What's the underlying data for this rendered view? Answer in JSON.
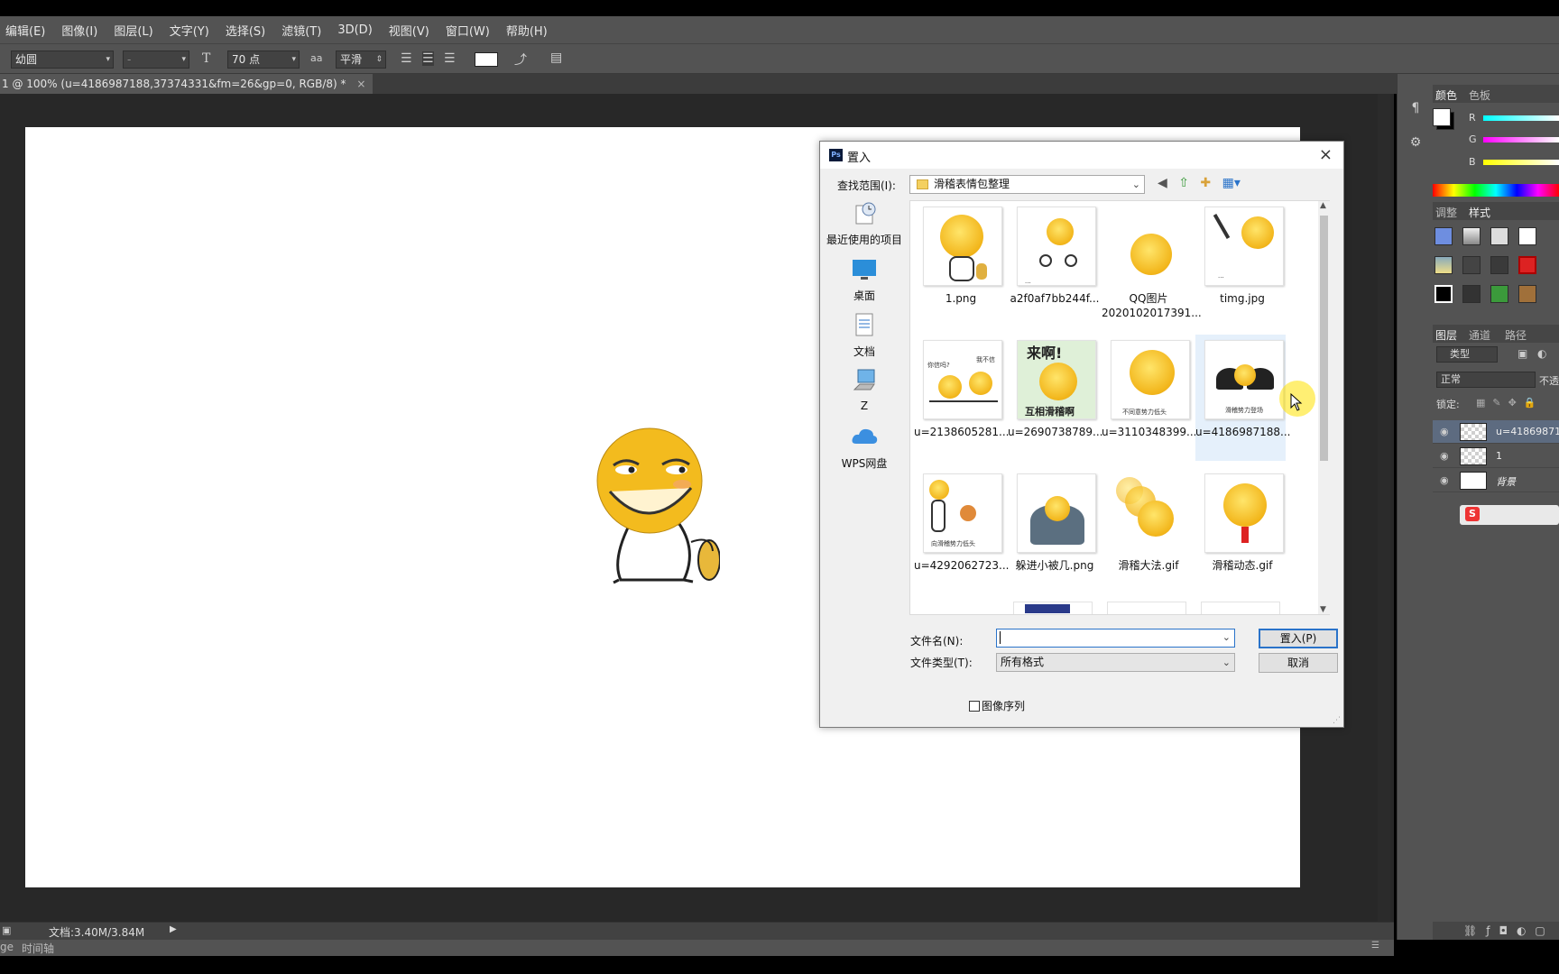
{
  "menu": [
    "编辑(E)",
    "图像(I)",
    "图层(L)",
    "文字(Y)",
    "选择(S)",
    "滤镜(T)",
    "3D(D)",
    "视图(V)",
    "窗口(W)",
    "帮助(H)"
  ],
  "options": {
    "font_family": "幼圆",
    "font_style": "-",
    "font_size": "70 点",
    "antialias_icon": "aa",
    "antialias": "平滑"
  },
  "document_tab": {
    "title": "1 @ 100% (u=4186987188,37374331&fm=26&gp=0, RGB/8) *",
    "close": "×"
  },
  "status": {
    "doc_info": "文档:3.40M/3.84M",
    "timeline_prefix": "ge",
    "timeline_label": "时间轴"
  },
  "panels": {
    "color_tabs": [
      "颜色",
      "色板"
    ],
    "channels": [
      "R",
      "G",
      "B"
    ],
    "adjust_tabs": [
      "调整",
      "样式"
    ],
    "layers_tabs": [
      "图层",
      "通道",
      "路径"
    ],
    "kind_filter": "类型",
    "blend_mode": "正常",
    "opacity_label": "不透",
    "lock_label": "锁定:",
    "layers": [
      {
        "name": "u=41869871",
        "selected": true
      },
      {
        "name": "1",
        "selected": false
      },
      {
        "name": "背景",
        "selected": false
      }
    ]
  },
  "dialog": {
    "title": "置入",
    "close": "×",
    "look_in_label": "查找范围(I):",
    "look_in_value": "滑稽表情包整理",
    "places": [
      {
        "label": "最近使用的项目",
        "icon": "recent-icon"
      },
      {
        "label": "桌面",
        "icon": "desktop-icon"
      },
      {
        "label": "文档",
        "icon": "document-icon"
      },
      {
        "label": "Z",
        "icon": "computer-icon"
      },
      {
        "label": "WPS网盘",
        "icon": "cloud-icon"
      }
    ],
    "files": [
      {
        "name": "1.png",
        "name2": ""
      },
      {
        "name": "a2f0af7bb244f...",
        "name2": ""
      },
      {
        "name": "QQ图片",
        "name2": "2020102017391..."
      },
      {
        "name": "timg.jpg",
        "name2": ""
      },
      {
        "name": "u=2138605281...",
        "name2": ""
      },
      {
        "name": "u=2690738789...",
        "name2": ""
      },
      {
        "name": "u=3110348399...",
        "name2": ""
      },
      {
        "name": "u=4186987188...",
        "name2": ""
      },
      {
        "name": "u=4292062723...",
        "name2": ""
      },
      {
        "name": "躲进小被几.png",
        "name2": ""
      },
      {
        "name": "滑稽大法.gif",
        "name2": ""
      },
      {
        "name": "滑稽动态.gif",
        "name2": ""
      }
    ],
    "thumb_texts": {
      "laila": "来啊!",
      "huxiang": "互相滑稽啊",
      "xinma": "你信吗?",
      "buxin": "我不信",
      "butong": "不同意势力低头",
      "dengchang": "滑稽势力登场",
      "nuli": "向滑稽势力低头"
    },
    "file_name_label": "文件名(N):",
    "file_name_value": "",
    "file_type_label": "文件类型(T):",
    "file_type_value": "所有格式",
    "place_button": "置入(P)",
    "cancel_button": "取消",
    "image_sequence": "图像序列"
  },
  "colors": {
    "accent": "#2a73c9",
    "selected_layer": "#5d6b80",
    "emoji_yellow": "#f2b51a"
  }
}
